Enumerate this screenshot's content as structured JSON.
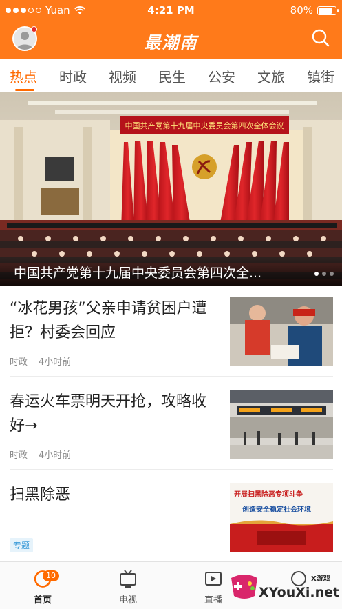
{
  "status_bar": {
    "carrier": "Yuan",
    "time": "4:21 PM",
    "battery": "80%",
    "battery_level": 0.8
  },
  "header": {
    "title": "最潮南",
    "has_notification": true
  },
  "tabs": [
    {
      "label": "热点",
      "active": true
    },
    {
      "label": "时政"
    },
    {
      "label": "视频"
    },
    {
      "label": "民生"
    },
    {
      "label": "公安"
    },
    {
      "label": "文旅"
    },
    {
      "label": "镇街"
    }
  ],
  "hero": {
    "banner_text": "中国共产党第十九届中央委员会第四次全体会议",
    "caption": "中国共产党第十九届中央委员会第四次全..."
  },
  "news": [
    {
      "title": "“冰花男孩”父亲申请贫困户遭拒？村委会回应",
      "category": "时政",
      "time": "4小时前"
    },
    {
      "title": "春运火车票明天开抢，攻略收好→",
      "category": "时政",
      "time": "4小时前"
    },
    {
      "title": "扫黑除恶",
      "badge": "专题",
      "thumb_line1": "开展扫黑除恶专项斗争",
      "thumb_line2": "创造安全稳定社会环境"
    }
  ],
  "bottom_nav": [
    {
      "label": "首页",
      "badge": "10",
      "active": true
    },
    {
      "label": "电视"
    },
    {
      "label": "直播"
    },
    {
      "label": ""
    }
  ],
  "watermark": {
    "text": "XYouXi.net",
    "small": "X游戏"
  },
  "colors": {
    "brand": "#ff7a1a",
    "accent": "#ff6a00",
    "tag_blue": "#3b9bd8"
  },
  "icons": {
    "avatar": "user-avatar-icon",
    "search": "search-icon",
    "home": "home-refresh-icon",
    "tv": "tv-icon",
    "live": "live-play-icon",
    "wifi": "wifi-icon",
    "battery": "battery-icon"
  }
}
